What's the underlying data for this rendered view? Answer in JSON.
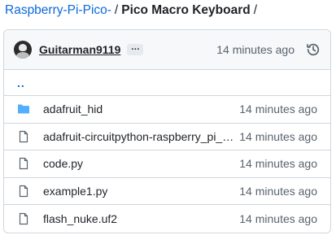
{
  "breadcrumb": {
    "repo": "Raspberry-Pi-Pico-",
    "separator": "/",
    "folder": "Pico Macro Keyboard",
    "trailing": "/"
  },
  "commit": {
    "author": "Guitarman9119",
    "ellipsis": "…",
    "time": "14 minutes ago",
    "icons": {
      "avatar": "user-avatar",
      "history": "history-clock-icon"
    }
  },
  "parent": {
    "label": ".."
  },
  "files": [
    {
      "name": "adafruit_hid",
      "type": "folder",
      "icon": "folder-icon",
      "age": "14 minutes ago"
    },
    {
      "name": "adafruit-circuitpython-raspberry_pi_pico-e...",
      "type": "file",
      "icon": "file-icon",
      "age": "14 minutes ago"
    },
    {
      "name": "code.py",
      "type": "file",
      "icon": "file-icon",
      "age": "14 minutes ago"
    },
    {
      "name": "example1.py",
      "type": "file",
      "icon": "file-icon",
      "age": "14 minutes ago"
    },
    {
      "name": "flash_nuke.uf2",
      "type": "file",
      "icon": "file-icon",
      "age": "14 minutes ago"
    }
  ],
  "colors": {
    "link": "#0969da",
    "folder": "#54aeff",
    "muted": "#59636e",
    "border": "#d0d7de",
    "header_bg": "#f6f8fa"
  }
}
